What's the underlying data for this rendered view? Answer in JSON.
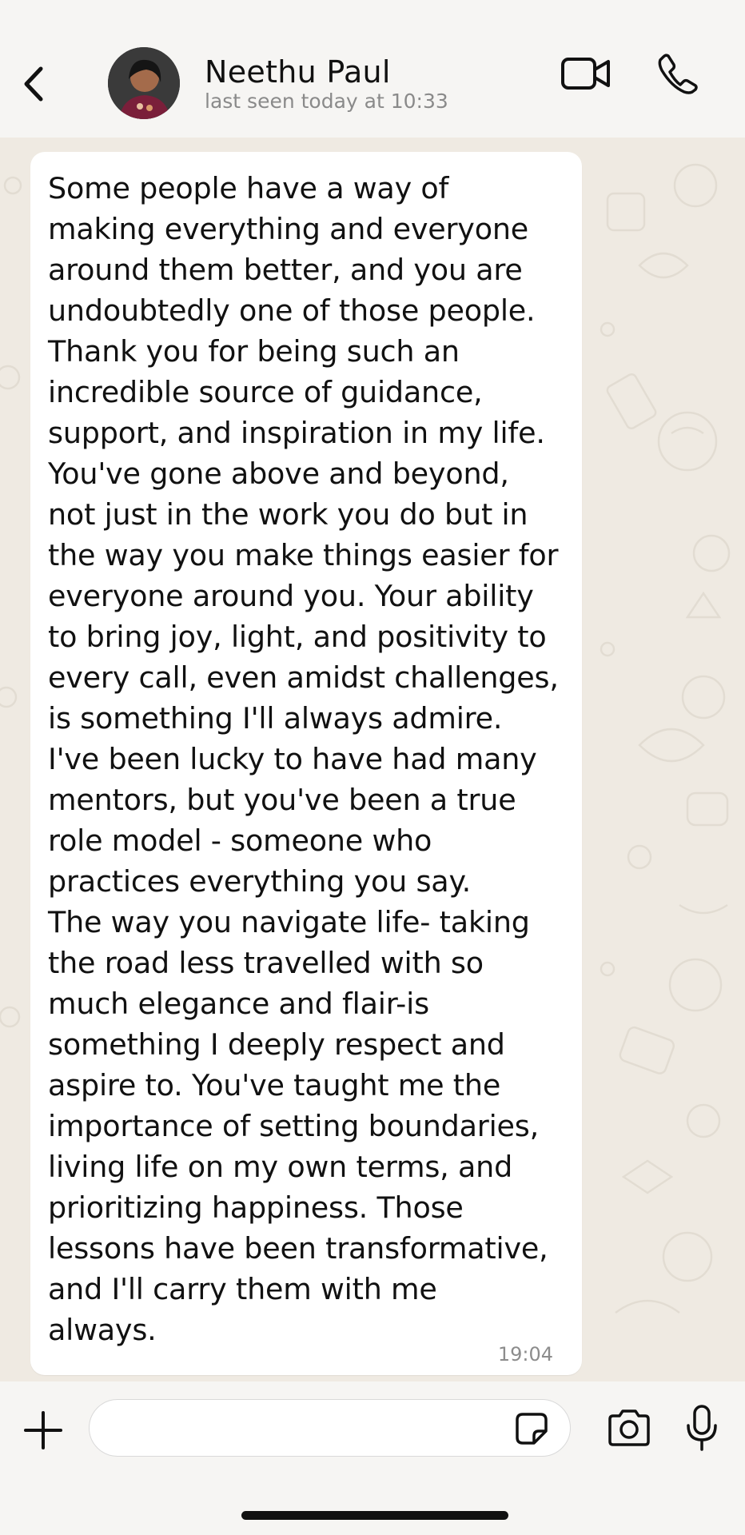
{
  "header": {
    "contact_name": "Neethu Paul",
    "status": "last seen today at 10:33",
    "back_icon": "chevron-left-icon",
    "video_icon": "video-camera-icon",
    "call_icon": "phone-icon"
  },
  "message": {
    "text": "Some people have a way of\nmaking everything and everyone\naround them better, and you are\nundoubtedly one of those people.\nThank you for being such an\nincredible source of guidance,\nsupport, and inspiration in my life.\nYou've gone above and beyond,\nnot just in the work you do but in\nthe way you make things easier for\neveryone around you. Your ability\nto bring joy, light, and positivity to\nevery call, even amidst challenges,\nis something I'll always admire.\nI've been lucky to have had many\nmentors, but you've been a true\nrole model - someone who\npractices everything you say.\nThe way you navigate life- taking\nthe road less travelled with so\nmuch elegance and flair-is\nsomething I deeply respect and\naspire to. You've taught me the\nimportance of setting boundaries,\nliving life on my own terms, and\nprioritizing happiness. Those\nlessons have been transformative,\nand I'll carry them with me\nalways.",
    "time": "19:04"
  },
  "composer": {
    "value": "",
    "placeholder": "",
    "plus_icon": "plus-icon",
    "sticker_icon": "sticker-icon",
    "camera_icon": "camera-icon",
    "mic_icon": "microphone-icon"
  },
  "colors": {
    "header_bg": "#f6f5f3",
    "chat_bg": "#efeae2",
    "bubble_bg": "#ffffff",
    "text": "#111111",
    "muted": "#8a8a8a"
  }
}
